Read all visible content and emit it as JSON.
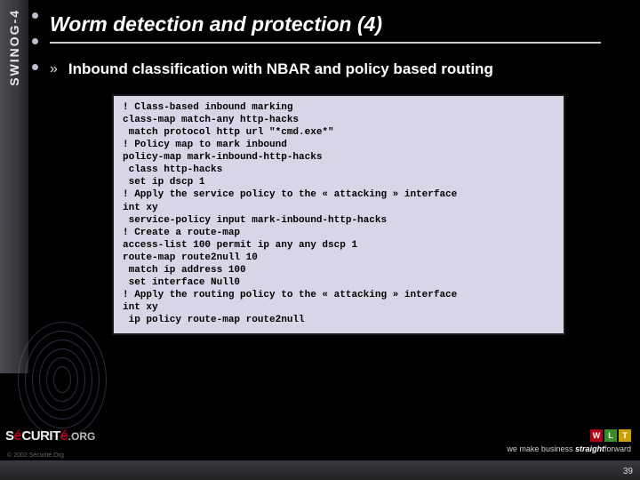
{
  "sidebar": {
    "label": "SWINOG-4"
  },
  "title": "Worm detection and protection (4)",
  "bullet": {
    "arrow": "»",
    "text": "Inbound classification with NBAR and policy based routing"
  },
  "code": "! Class-based inbound marking\nclass-map match-any http-hacks\n match protocol http url \"*cmd.exe*\"\n! Policy map to mark inbound\npolicy-map mark-inbound-http-hacks\n class http-hacks\n set ip dscp 1\n! Apply the service policy to the « attacking » interface\nint xy\n service-policy input mark-inbound-http-hacks\n! Create a route-map\naccess-list 100 permit ip any any dscp 1\nroute-map route2null 10\n match ip address 100\n set interface Null0\n! Apply the routing policy to the « attacking » interface\nint xy\n ip policy route-map route2null",
  "footer": {
    "logo_prefix": "S",
    "logo_accent": "é",
    "logo_rest": "CURIT",
    "logo_accent2": "é",
    "logo_org": ".ORG",
    "tag_pre": "we make business ",
    "tag_em": "straight",
    "tag_post": "forward",
    "copyright": "© 2002 Sécurité.Org",
    "pagenum": "39",
    "sq1": "W",
    "sq2": "L",
    "sq3": "T"
  }
}
